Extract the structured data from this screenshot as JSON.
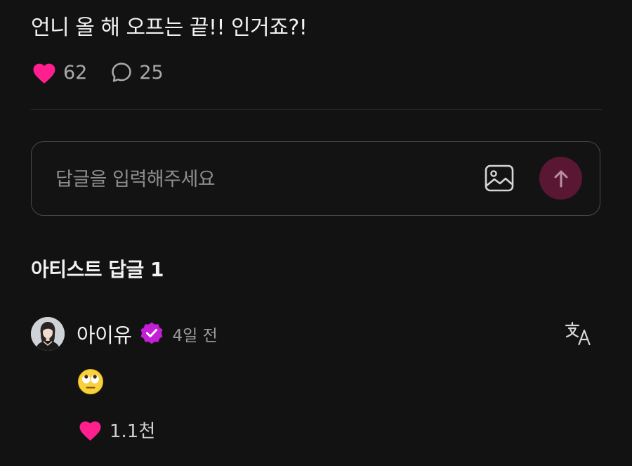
{
  "post": {
    "text": "언니 올 해 오프는 끝!! 인거죠?!",
    "like_count": "62",
    "comment_count": "25"
  },
  "reply": {
    "placeholder": "답글을 입력해주세요",
    "image_icon": "image-icon",
    "send_icon": "arrow-up-icon"
  },
  "artist_replies": {
    "title": "아티스트 답글 1",
    "items": [
      {
        "author": "아이유",
        "verified_icon": "verified-badge-icon",
        "time": "4일 전",
        "emoji_icon": "face-with-rolling-eyes-icon",
        "like_count": "1.1천"
      }
    ]
  },
  "colors": {
    "background": "#121212",
    "heart": "#ff1f8e",
    "send_button": "#5a1734",
    "verified_badge": "#c41fd6"
  }
}
